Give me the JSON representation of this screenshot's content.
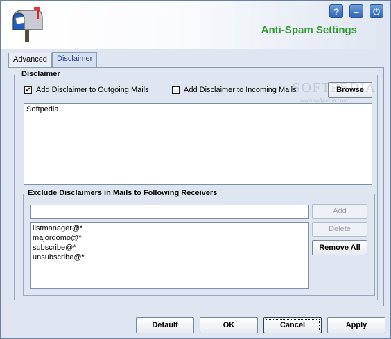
{
  "header": {
    "title": "Anti-Spam Settings",
    "help_icon": "?",
    "minimize_icon": "–",
    "power_icon": "⏻"
  },
  "tabs": [
    {
      "label": "Advanced",
      "active": false
    },
    {
      "label": "Disclaimer",
      "active": true
    }
  ],
  "disclaimer": {
    "group_label": "Disclaimer",
    "outgoing": {
      "label": "Add Disclaimer to Outgoing Mails",
      "checked": true
    },
    "incoming": {
      "label": "Add Disclaimer to Incoming Mails",
      "checked": false
    },
    "browse_label": "Browse",
    "text": "Softpedia"
  },
  "exclude": {
    "group_label": "Exclude Disclaimers in Mails to Following Receivers",
    "input_value": "",
    "add_label": "Add",
    "delete_label": "Delete",
    "remove_all_label": "Remove All",
    "receivers": [
      "listmanager@*",
      "majordomo@*",
      "subscribe@*",
      "unsubscribe@*"
    ]
  },
  "footer": {
    "default_label": "Default",
    "ok_label": "OK",
    "cancel_label": "Cancel",
    "apply_label": "Apply"
  },
  "watermark": {
    "brand": "SOFTPEDIA",
    "url": "www.softpedia.com"
  },
  "colors": {
    "title_green": "#2e9a2e",
    "tab_active_text": "#1c3f93",
    "background": "#dfe6f1"
  }
}
